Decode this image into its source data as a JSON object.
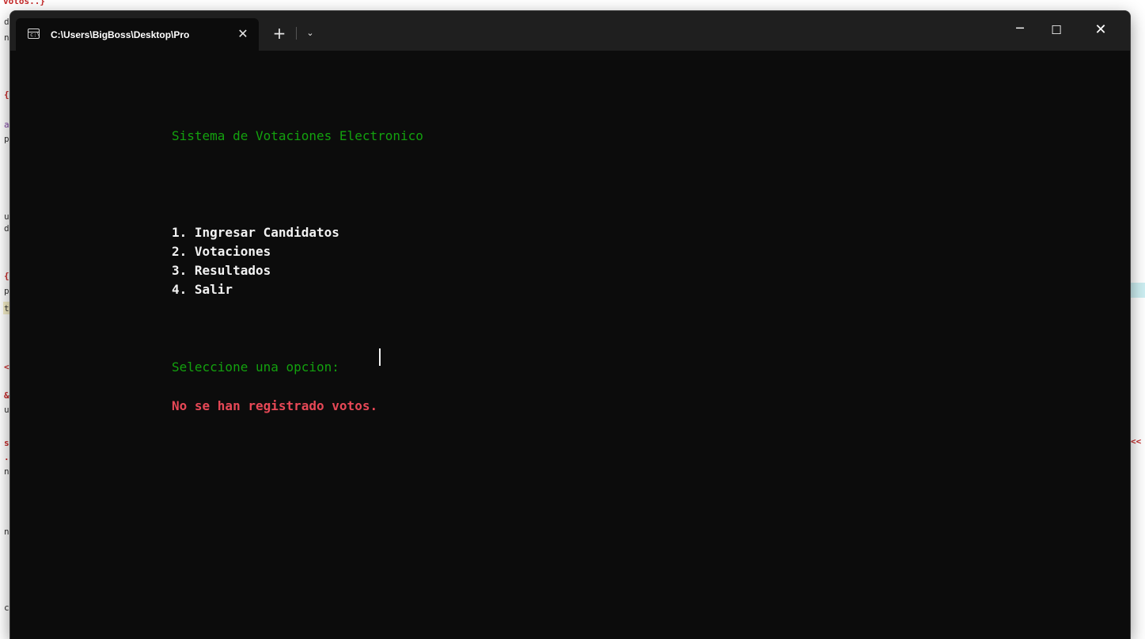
{
  "background": {
    "top_fragment": "votos..}",
    "left_fragments": [
      "d",
      "n",
      "{",
      "a",
      "p",
      "u",
      "d",
      "{",
      "p",
      "t",
      "<",
      "&",
      "u",
      "s",
      ".",
      "n",
      "n",
      "c"
    ],
    "right_fragment": "<<"
  },
  "window": {
    "tab_title": "C:\\Users\\BigBoss\\Desktop\\Pro",
    "tab_icon": "cmd-icon",
    "tab_close_glyph": "✕",
    "new_tab_glyph": "+",
    "dropdown_glyph": "⌄",
    "minimize_glyph": "─",
    "maximize_glyph": "☐",
    "close_glyph": "✕"
  },
  "console": {
    "title": "Sistema de Votaciones Electronico",
    "menu": [
      "1. Ingresar Candidatos",
      "2. Votaciones",
      "3. Resultados",
      "4. Salir"
    ],
    "prompt": "Seleccione una opcion: ",
    "message": "No se han registrado votos."
  },
  "colors": {
    "console_bg": "#0c0c0c",
    "green_text": "#13a10e",
    "menu_text": "#f2f2f2",
    "error_text": "#e74856"
  }
}
